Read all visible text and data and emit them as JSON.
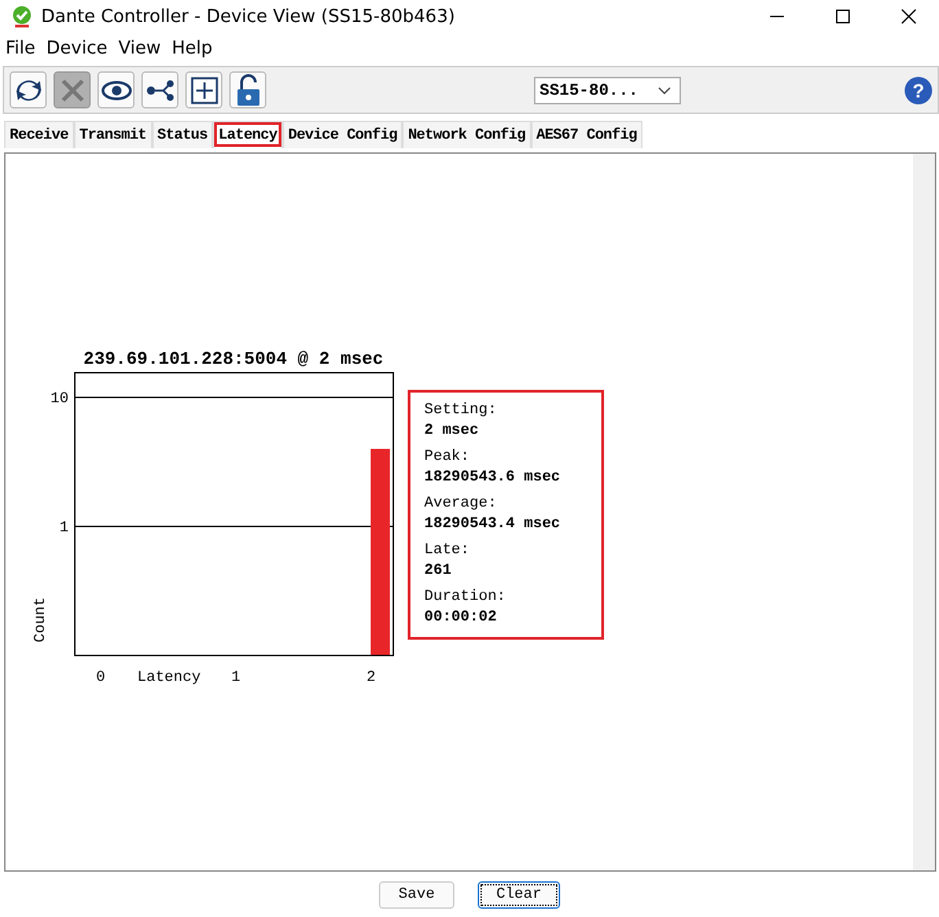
{
  "window": {
    "title": "Dante Controller - Device View (SS15-80b463)"
  },
  "menu": [
    "File",
    "Device",
    "View",
    "Help"
  ],
  "toolbar": {
    "buttons": [
      {
        "kind": "refresh",
        "disabled": false
      },
      {
        "kind": "tools",
        "disabled": true
      },
      {
        "kind": "eye",
        "disabled": false
      },
      {
        "kind": "share",
        "disabled": false
      },
      {
        "kind": "add",
        "disabled": false
      },
      {
        "kind": "lock",
        "disabled": false
      }
    ],
    "device_select": {
      "value": "SS15-80..."
    },
    "help": "?"
  },
  "tabs": [
    {
      "label": "Receive",
      "selected": false
    },
    {
      "label": "Transmit",
      "selected": false
    },
    {
      "label": "Status",
      "selected": false
    },
    {
      "label": "Latency",
      "selected": true
    },
    {
      "label": "Device Config",
      "selected": false
    },
    {
      "label": "Network Config",
      "selected": false
    },
    {
      "label": "AES67 Config",
      "selected": false
    }
  ],
  "latency": {
    "histogram": {
      "title": "239.69.101.228:5004 @ 2 msec",
      "xlabel": "Latency",
      "ylabel": "Count",
      "x_labels": [
        "0",
        "1",
        "2"
      ],
      "y_labels": [
        "10",
        "1"
      ]
    },
    "stats": [
      {
        "label": "Setting:",
        "value": "2 msec"
      },
      {
        "label": "Peak:",
        "value": "18290543.6 msec"
      },
      {
        "label": "Average:",
        "value": "18290543.4 msec"
      },
      {
        "label": "Late:",
        "value": "261"
      },
      {
        "label": "Duration:",
        "value": "00:00:02"
      }
    ]
  },
  "buttons": [
    {
      "label": "Save",
      "focused": false
    },
    {
      "label": "Clear",
      "focused": true
    }
  ]
}
